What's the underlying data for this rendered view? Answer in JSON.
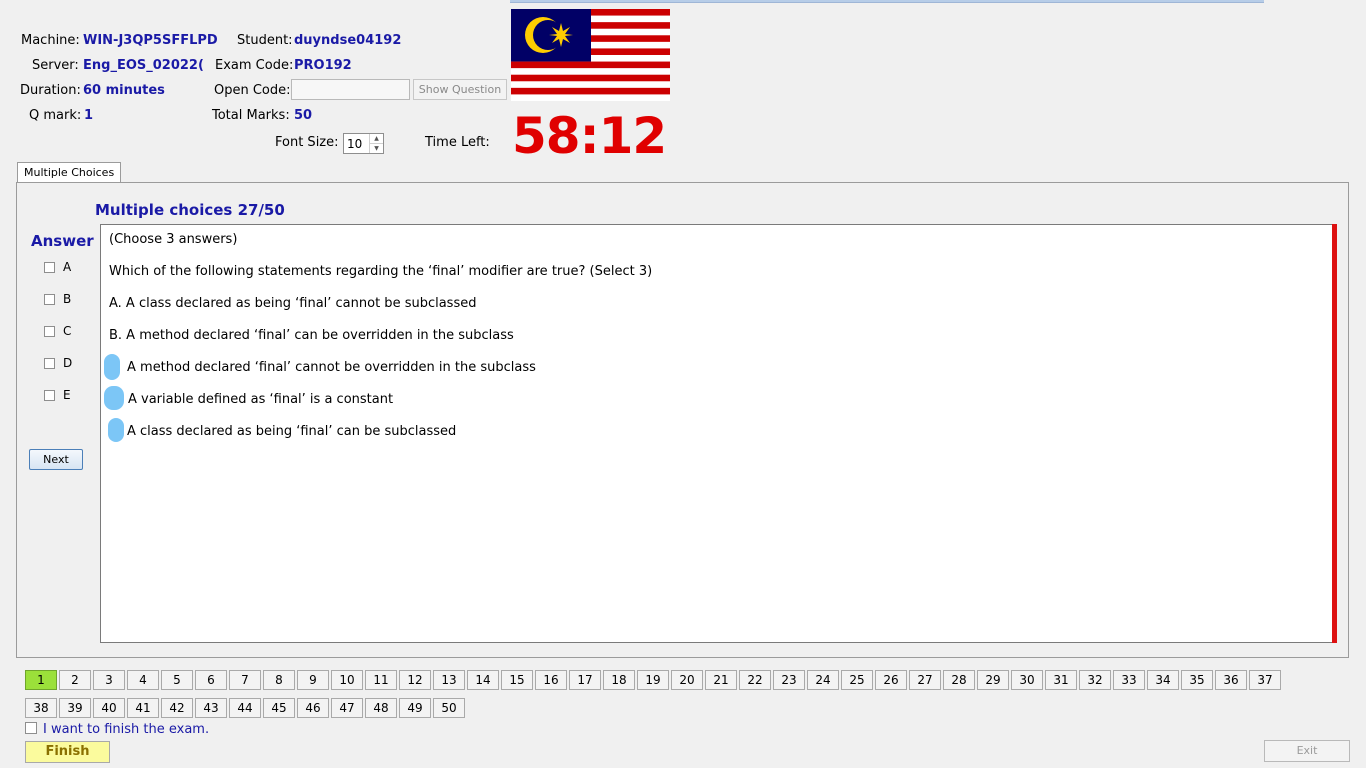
{
  "header": {
    "machine_label": "Machine:",
    "machine_value": "WIN-J3QP5SFFLPD",
    "student_label": "Student:",
    "student_value": "duyndse04192",
    "server_label": "Server:",
    "server_value": "Eng_EOS_02022(",
    "exam_code_label": "Exam Code:",
    "exam_code_value": "PRO192",
    "duration_label": "Duration:",
    "duration_value": "60 minutes",
    "open_code_label": "Open Code:",
    "open_code_value": "",
    "show_question_label": "Show Question",
    "qmark_label": "Q mark:",
    "qmark_value": "1",
    "total_marks_label": "Total Marks:",
    "total_marks_value": "50",
    "font_size_label": "Font Size:",
    "font_size_value": "10",
    "time_left_label": "Time Left:",
    "time_left_value": "58:12",
    "flag_icon": "malaysia-flag-icon"
  },
  "tabs": [
    {
      "label": "Multiple Choices"
    }
  ],
  "question": {
    "title": "Multiple choices 27/50",
    "lines": [
      "(Choose 3 answers)",
      "Which of the following statements regarding the ‘final’ modifier are true? (Select 3)",
      "A.  A class declared as being ‘final’ cannot be subclassed",
      "B.  A method declared ‘final’ can be overridden in the subclass",
      "A method declared ‘final’ cannot be overridden in the subclass",
      "A variable defined as ‘final’ is a constant",
      "A class declared as being ‘final’ can be subclassed"
    ]
  },
  "answer": {
    "title": "Answer",
    "options": [
      "A",
      "B",
      "C",
      "D",
      "E"
    ],
    "next_label": "Next"
  },
  "navigation": {
    "question_numbers": [
      "1",
      "2",
      "3",
      "4",
      "5",
      "6",
      "7",
      "8",
      "9",
      "10",
      "11",
      "12",
      "13",
      "14",
      "15",
      "16",
      "17",
      "18",
      "19",
      "20",
      "21",
      "22",
      "23",
      "24",
      "25",
      "26",
      "27",
      "28",
      "29",
      "30",
      "31",
      "32",
      "33",
      "34",
      "35",
      "36",
      "37",
      "38",
      "39",
      "40",
      "41",
      "42",
      "43",
      "44",
      "45",
      "46",
      "47",
      "48",
      "49",
      "50"
    ],
    "current": "1"
  },
  "footer": {
    "finish_check_label": "I want to finish the exam.",
    "finish_label": "Finish",
    "exit_label": "Exit"
  },
  "colors": {
    "value_blue": "#1a1aa6",
    "timer_red": "#e00000",
    "current_question_green": "#9be03a",
    "finish_yellow": "#fbfb9d"
  }
}
